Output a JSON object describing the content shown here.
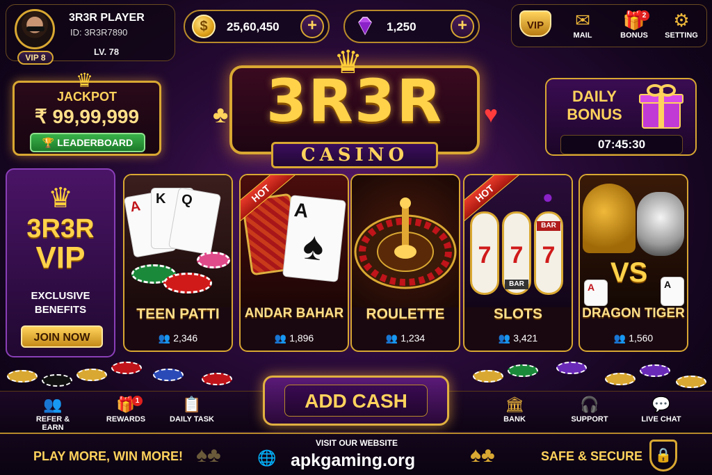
{
  "profile": {
    "name": "3R3R PLAYER",
    "id": "ID: 3R3R7890",
    "vip": "VIP 8",
    "level": "LV. 78"
  },
  "currency": {
    "coins": "25,60,450",
    "gems": "1,250",
    "coin_symbol": "$",
    "plus": "+"
  },
  "top_nav": {
    "vip_label": "VIP",
    "mail_label": "MAIL",
    "bonus_label": "BONUS",
    "bonus_badge": "2",
    "setting_label": "SETTING"
  },
  "jackpot": {
    "title": "JACKPOT",
    "amount": "₹ 99,99,999",
    "leaderboard": "LEADERBOARD"
  },
  "logo": {
    "title": "3R3R",
    "subtitle": "CASINO"
  },
  "daily_bonus": {
    "title": "DAILY BONUS",
    "timer": "07:45:30"
  },
  "vip_card": {
    "brand": "3R3R",
    "word": "VIP",
    "desc_line1": "EXCLUSIVE",
    "desc_line2": "BENEFITS",
    "join": "JOIN NOW"
  },
  "games": [
    {
      "name": "TEEN PATTI",
      "players": "2,346",
      "hot": ""
    },
    {
      "name": "ANDAR BAHAR",
      "players": "1,896",
      "hot": "HOT"
    },
    {
      "name": "ROULETTE",
      "players": "1,234",
      "hot": ""
    },
    {
      "name": "SLOTS",
      "players": "3,421",
      "hot": "HOT"
    },
    {
      "name": "DRAGON TIGER",
      "players": "1,560",
      "hot": ""
    }
  ],
  "game_art": {
    "slot_bar": "BAR",
    "dragon_vs": "VS",
    "teen_cards": [
      "A",
      "K",
      "Q"
    ],
    "andar_card": "A",
    "dragon_cards": [
      "A",
      "A"
    ]
  },
  "bottom_nav": {
    "refer": "REFER & EARN",
    "rewards": "REWARDS",
    "rewards_badge": "1",
    "daily_task": "DAILY TASK",
    "add_cash": "ADD CASH",
    "bank": "BANK",
    "support": "SUPPORT",
    "live_chat": "LIVE CHAT"
  },
  "footer": {
    "left": "PLAY MORE, WIN MORE!",
    "web_label": "VISIT OUR WEBSITE",
    "website": "apkgaming.org",
    "right": "SAFE & SECURE"
  },
  "colors": {
    "accent_gold": "#ffd35c",
    "background": "#2a0b3a",
    "hot_red": "#e83a2a",
    "leaderboard_green": "#39b24a"
  },
  "icons": [
    "coin-icon",
    "gem-icon",
    "vip-crown-icon",
    "mail-icon",
    "gift-icon",
    "gear-icon",
    "trophy-icon",
    "users-icon",
    "bank-icon",
    "headset-icon",
    "chat-icon",
    "globe-icon",
    "shield-lock-icon",
    "task-icon"
  ]
}
